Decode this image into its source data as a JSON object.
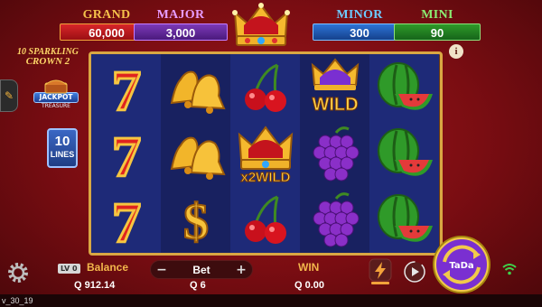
{
  "jackpots": {
    "grand": {
      "name": "GRAND",
      "value": "60,000"
    },
    "major": {
      "name": "MAJOR",
      "value": "3,000"
    },
    "minor": {
      "name": "MINOR",
      "value": "300"
    },
    "mini": {
      "name": "MINI",
      "value": "90"
    }
  },
  "game_logo": {
    "line1": "10 SPARKLING",
    "line2": "CROWN 2"
  },
  "jackpot_treasure": {
    "line1": "JACKPOT",
    "line2": "TREASURE"
  },
  "lines_badge": {
    "number": "10",
    "label": "LINES"
  },
  "info_label": "i",
  "reels": [
    [
      "seven",
      "seven",
      "seven"
    ],
    [
      "bell",
      "bell",
      "dollar"
    ],
    [
      "cherry",
      "crown",
      "cherry"
    ],
    [
      "wild",
      "grapes",
      "grapes"
    ],
    [
      "watermelon",
      "watermelon",
      "watermelon"
    ]
  ],
  "symbol_text": {
    "wild": "WILD",
    "x2wild": "x2WILD",
    "dollar": "$"
  },
  "bottom": {
    "level": "LV 0",
    "balance_label": "Balance",
    "balance_value": "Q 912.14",
    "bet_label": "Bet",
    "bet_value": "Q 6",
    "bet_minus": "−",
    "bet_plus": "+",
    "win_label": "WIN",
    "win_value": "Q 0.00",
    "spin_label": "TaDa"
  },
  "version": "v_30_19",
  "colors": {
    "frame_gold": "#d9a743",
    "reel_bg": "#1e2a78",
    "accent_purple": "#7a2fd1",
    "label_gold": "#f2b64b"
  }
}
